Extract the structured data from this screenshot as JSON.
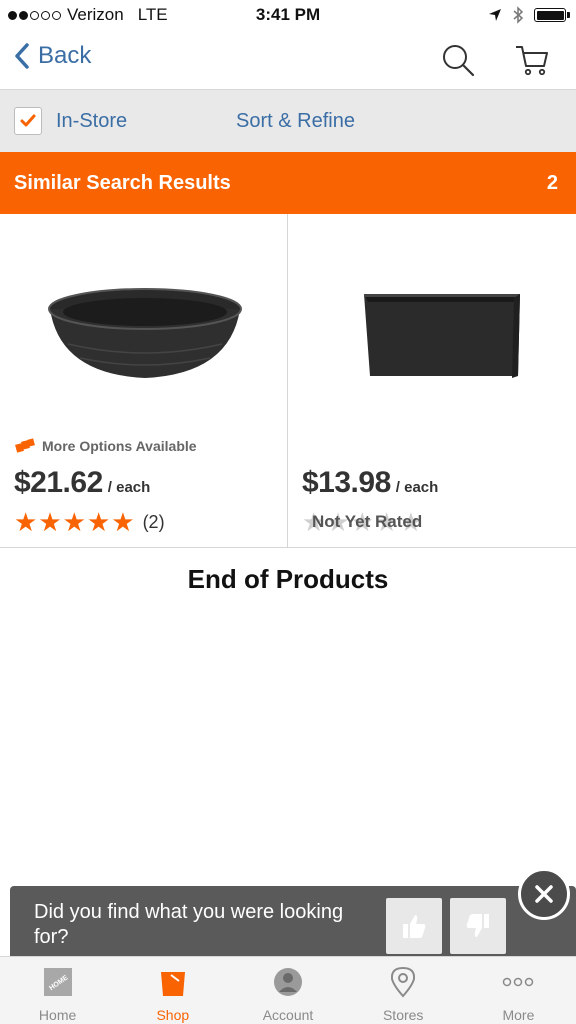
{
  "status_bar": {
    "carrier": "Verizon",
    "network": "LTE",
    "time": "3:41 PM",
    "signal_bars": 2
  },
  "nav": {
    "back_label": "Back",
    "search_icon": "search-icon",
    "cart_icon": "cart-icon"
  },
  "filter": {
    "instore_label": "In-Store",
    "instore_checked": true,
    "sort_label": "Sort & Refine"
  },
  "results": {
    "title": "Similar Search Results",
    "count": "2"
  },
  "products": [
    {
      "image": "black-bowl-planter",
      "more_options": "More Options Available",
      "price": "$21.62",
      "unit": "/ each",
      "stars": 5,
      "reviews": "(2)"
    },
    {
      "image": "black-rectangular-planter",
      "price": "$13.98",
      "unit": "/ each",
      "rating_text": "Not Yet Rated"
    }
  ],
  "end_text": "End of Products",
  "feedback": {
    "question": "Did you find what you were looking for?"
  },
  "tabs": [
    {
      "label": "Home",
      "icon": "home-depot-logo-icon"
    },
    {
      "label": "Shop",
      "icon": "bucket-icon",
      "active": true
    },
    {
      "label": "Account",
      "icon": "account-icon"
    },
    {
      "label": "Stores",
      "icon": "location-pin-icon"
    },
    {
      "label": "More",
      "icon": "more-dots-icon"
    }
  ],
  "colors": {
    "accent": "#f96302",
    "link": "#3a6ea5",
    "filter_bg": "#e9e9ea",
    "banner_bg": "#5a5a5a"
  }
}
